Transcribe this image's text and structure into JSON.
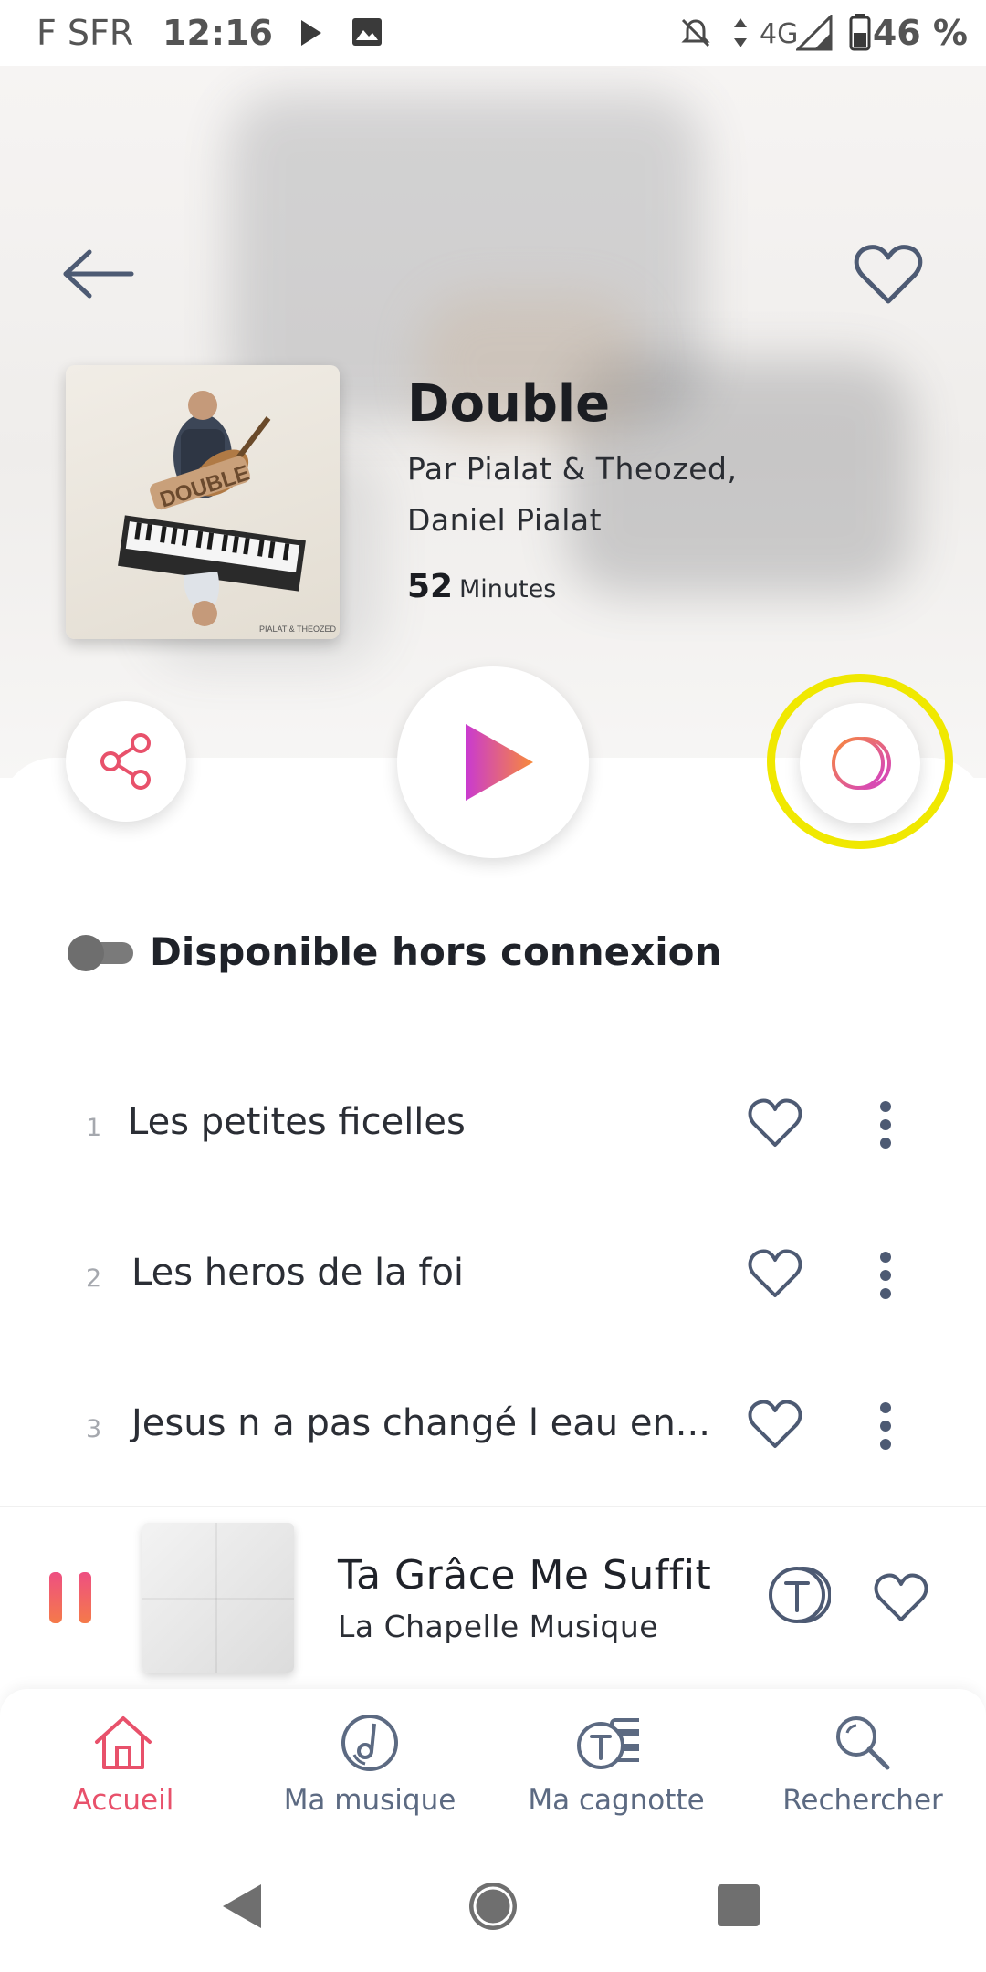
{
  "status_bar": {
    "carrier": "F SFR",
    "time": "12:16",
    "network": "4G",
    "battery": "46 %"
  },
  "album": {
    "title": "Double",
    "artist_line1": "Par Pialat & Theozed,",
    "artist_line2": "Daniel Pialat",
    "duration_value": "52",
    "duration_unit": "Minutes",
    "cover_word": "DOUBLE",
    "cover_credit": "PIALAT & THEOZED"
  },
  "offline": {
    "label": "Disponible hors connexion",
    "enabled": false
  },
  "tracks": [
    {
      "number": "1",
      "title": "Les petites ficelles"
    },
    {
      "number": "2",
      "title": "Les heros de la foi"
    },
    {
      "number": "3",
      "title": "Jesus n a pas changé l eau en..."
    }
  ],
  "now_playing": {
    "title": "Ta Grâce Me Suffit",
    "artist": "La Chapelle Musique",
    "state": "playing"
  },
  "bottom_nav": {
    "items": [
      {
        "label": "Accueil",
        "icon": "home-icon",
        "active": true
      },
      {
        "label": "Ma musique",
        "icon": "music-disc-icon",
        "active": false
      },
      {
        "label": "Ma cagnotte",
        "icon": "coins-icon",
        "active": false
      },
      {
        "label": "Rechercher",
        "icon": "search-icon",
        "active": false
      }
    ]
  },
  "colors": {
    "accent": "#e8516b",
    "gradient_start": "#cf3fd0",
    "gradient_end": "#f7873a",
    "icon_blue": "#4d5a73",
    "highlight": "#f0e800"
  }
}
